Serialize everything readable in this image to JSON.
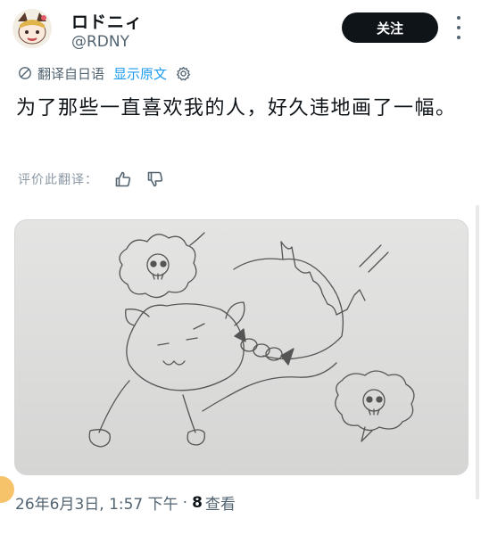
{
  "user": {
    "display_name": "ロドニィ",
    "handle": "@RDNY"
  },
  "header": {
    "follow_label": "关注",
    "more_icon": "more-vertical-icon"
  },
  "translation": {
    "translated_label": "翻译自日语",
    "show_original_label": "显示原文",
    "icon": "translate-icon",
    "settings_icon": "gear-icon"
  },
  "tweet": {
    "text": "为了那些一直喜欢我的人，好久违地画了一幅。"
  },
  "rate": {
    "label": "评价此翻译：",
    "up_icon": "thumbs-up-icon",
    "down_icon": "thumbs-down-icon"
  },
  "footer": {
    "timestamp": "26年6月3日, 1:57 下午",
    "separator": "·",
    "views_count": "8",
    "views_label": "查看"
  },
  "colors": {
    "accent": "#1d9bf0",
    "text": "#0f1419",
    "muted": "#536471",
    "button_bg": "#0f1419"
  }
}
